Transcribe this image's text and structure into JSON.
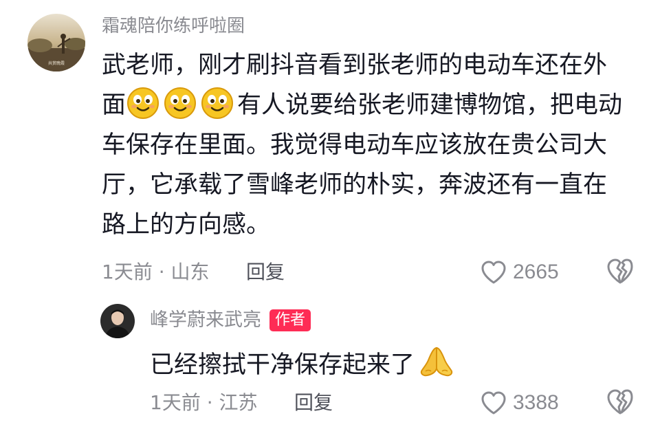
{
  "comment": {
    "username": "霜魂陪你练呼啦圈",
    "avatar_caption": "共赏晚霞",
    "lines": [
      "武老师，刚才刷抖音看到张老师的电动车还在外",
      "有人说要给张老师建博物馆，把电动",
      "车保存在里面。我觉得电动车应该放在贵公司大",
      "厅，它承载了雪峰老师的朴实，奔波还有一直在",
      "路上的方向感。"
    ],
    "line2_prefix": "面",
    "emoji_name": "smile-emoji",
    "time": "1天前",
    "separator": "·",
    "location": "山东",
    "reply_label": "回复",
    "likes": "2665"
  },
  "reply": {
    "username": "峰学蔚来武亮",
    "badge": "作者",
    "text": "已经擦拭干净保存起来了",
    "emoji_name": "folded-hands-emoji",
    "time": "1天前",
    "separator": "·",
    "location": "江苏",
    "reply_label": "回复",
    "likes": "3388"
  },
  "colors": {
    "text_primary": "#161823",
    "text_secondary": "#8a8b91",
    "badge": "#fe2c55"
  }
}
